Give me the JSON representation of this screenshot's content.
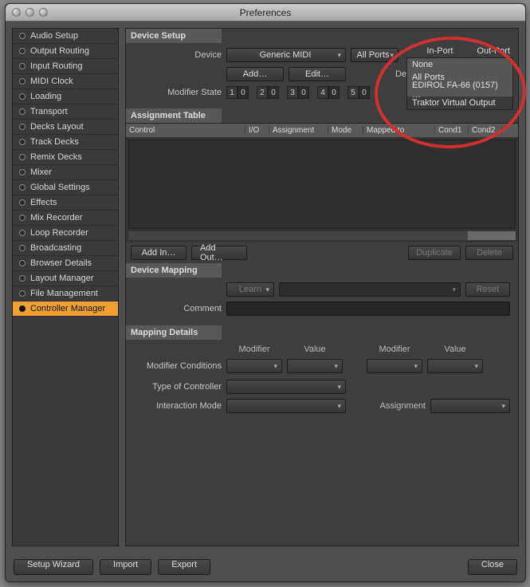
{
  "window": {
    "title": "Preferences"
  },
  "sidebar": {
    "items": [
      "Audio Setup",
      "Output Routing",
      "Input Routing",
      "MIDI Clock",
      "Loading",
      "Transport",
      "Decks Layout",
      "Track Decks",
      "Remix Decks",
      "Mixer",
      "Global Settings",
      "Effects",
      "Mix Recorder",
      "Loop Recorder",
      "Broadcasting",
      "Browser Details",
      "Layout Manager",
      "File Management",
      "Controller Manager"
    ],
    "selected_index": 18
  },
  "device_setup": {
    "header": "Device Setup",
    "device_label": "Device",
    "device_value": "Generic MIDI",
    "add_label": "Add…",
    "edit_label": "Edit…",
    "in_port_label": "In-Port",
    "out_port_label": "Out-Port",
    "in_port_value": "All Ports",
    "device_target_label": "Device",
    "modifier_label": "Modifier State",
    "modifiers": [
      {
        "n": "1",
        "v": "0"
      },
      {
        "n": "2",
        "v": "0"
      },
      {
        "n": "3",
        "v": "0"
      },
      {
        "n": "4",
        "v": "0"
      },
      {
        "n": "5",
        "v": "0"
      }
    ]
  },
  "outport_menu": {
    "items": [
      "None",
      "All Ports",
      "EDIROL FA-66 (0157) …",
      "Traktor Virtual Output"
    ],
    "highlighted_index": 3
  },
  "assignment_table": {
    "header": "Assignment Table",
    "columns": [
      "Control",
      "I/O",
      "Assignment",
      "Mode",
      "Mapped to",
      "Cond1",
      "Cond2"
    ]
  },
  "table_buttons": {
    "add_in": "Add In…",
    "add_out": "Add Out…",
    "duplicate": "Duplicate",
    "delete": "Delete"
  },
  "device_mapping": {
    "header": "Device Mapping",
    "learn": "Learn",
    "reset": "Reset",
    "comment_label": "Comment"
  },
  "mapping_details": {
    "header": "Mapping Details",
    "col_modifier": "Modifier",
    "col_value": "Value",
    "modifier_conditions": "Modifier Conditions",
    "type_of_controller": "Type of Controller",
    "interaction_mode": "Interaction Mode",
    "assignment": "Assignment"
  },
  "footer": {
    "setup_wizard": "Setup Wizard",
    "import": "Import",
    "export": "Export",
    "close": "Close"
  }
}
